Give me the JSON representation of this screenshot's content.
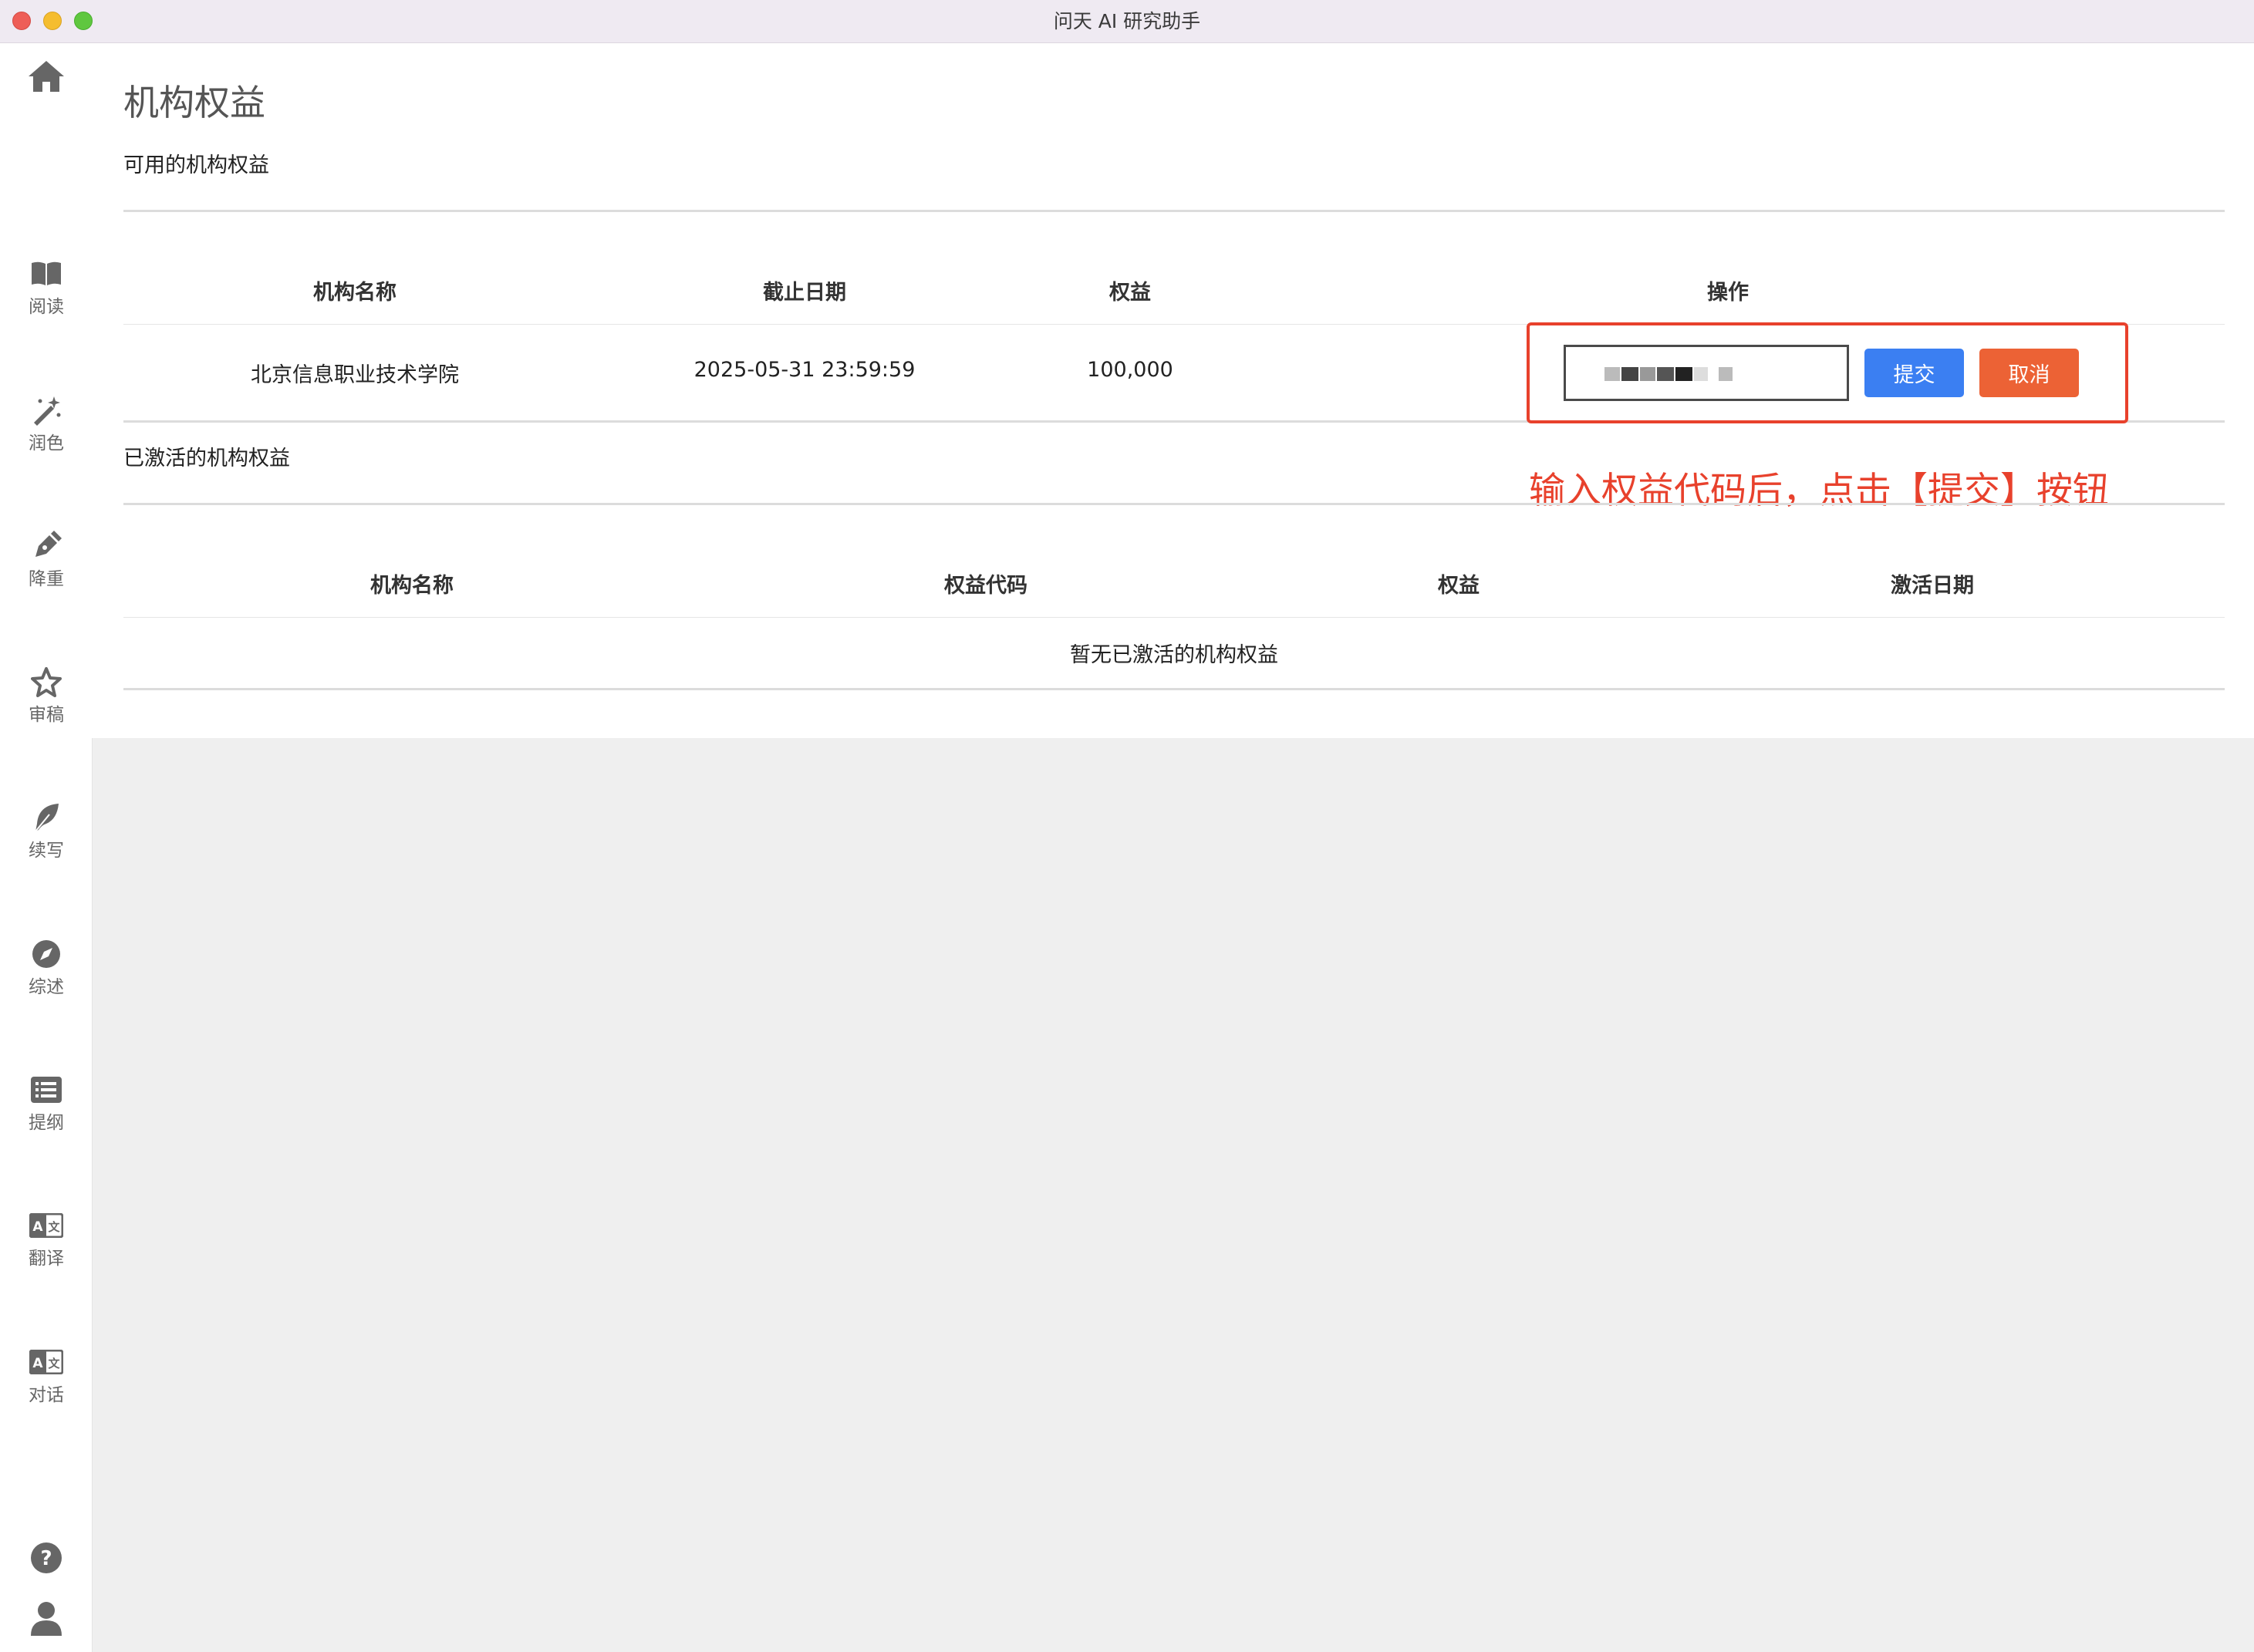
{
  "window": {
    "title": "问天 AI 研究助手"
  },
  "sidebar": {
    "home_icon": "home-icon",
    "items": [
      {
        "label": "阅读",
        "icon": "book-icon"
      },
      {
        "label": "润色",
        "icon": "magic-wand-icon"
      },
      {
        "label": "降重",
        "icon": "pen-icon"
      },
      {
        "label": "审稿",
        "icon": "star-icon"
      },
      {
        "label": "续写",
        "icon": "feather-icon"
      },
      {
        "label": "综述",
        "icon": "compass-icon"
      },
      {
        "label": "提纲",
        "icon": "list-icon"
      },
      {
        "label": "翻译",
        "icon": "translate-icon"
      },
      {
        "label": "对话",
        "icon": "chat-translate-icon"
      }
    ],
    "help_icon": "help-icon",
    "user_icon": "user-icon"
  },
  "main": {
    "page_title": "机构权益",
    "available": {
      "section_label": "可用的机构权益",
      "headers": [
        "机构名称",
        "截止日期",
        "权益",
        "操作"
      ],
      "rows": [
        {
          "institution": "北京信息职业技术学院",
          "deadline": "2025-05-31 23:59:59",
          "credits": "100,000"
        }
      ],
      "submit_label": "提交",
      "cancel_label": "取消"
    },
    "annotation": "输入权益代码后，点击【提交】按钮",
    "activated": {
      "section_label": "已激活的机构权益",
      "headers": [
        "机构名称",
        "权益代码",
        "权益",
        "激活日期"
      ],
      "empty_text": "暂无已激活的机构权益"
    }
  },
  "colors": {
    "accent_blue": "#3b7ff2",
    "cancel_orange": "#ec6235",
    "annotation_red": "#e8412c"
  }
}
